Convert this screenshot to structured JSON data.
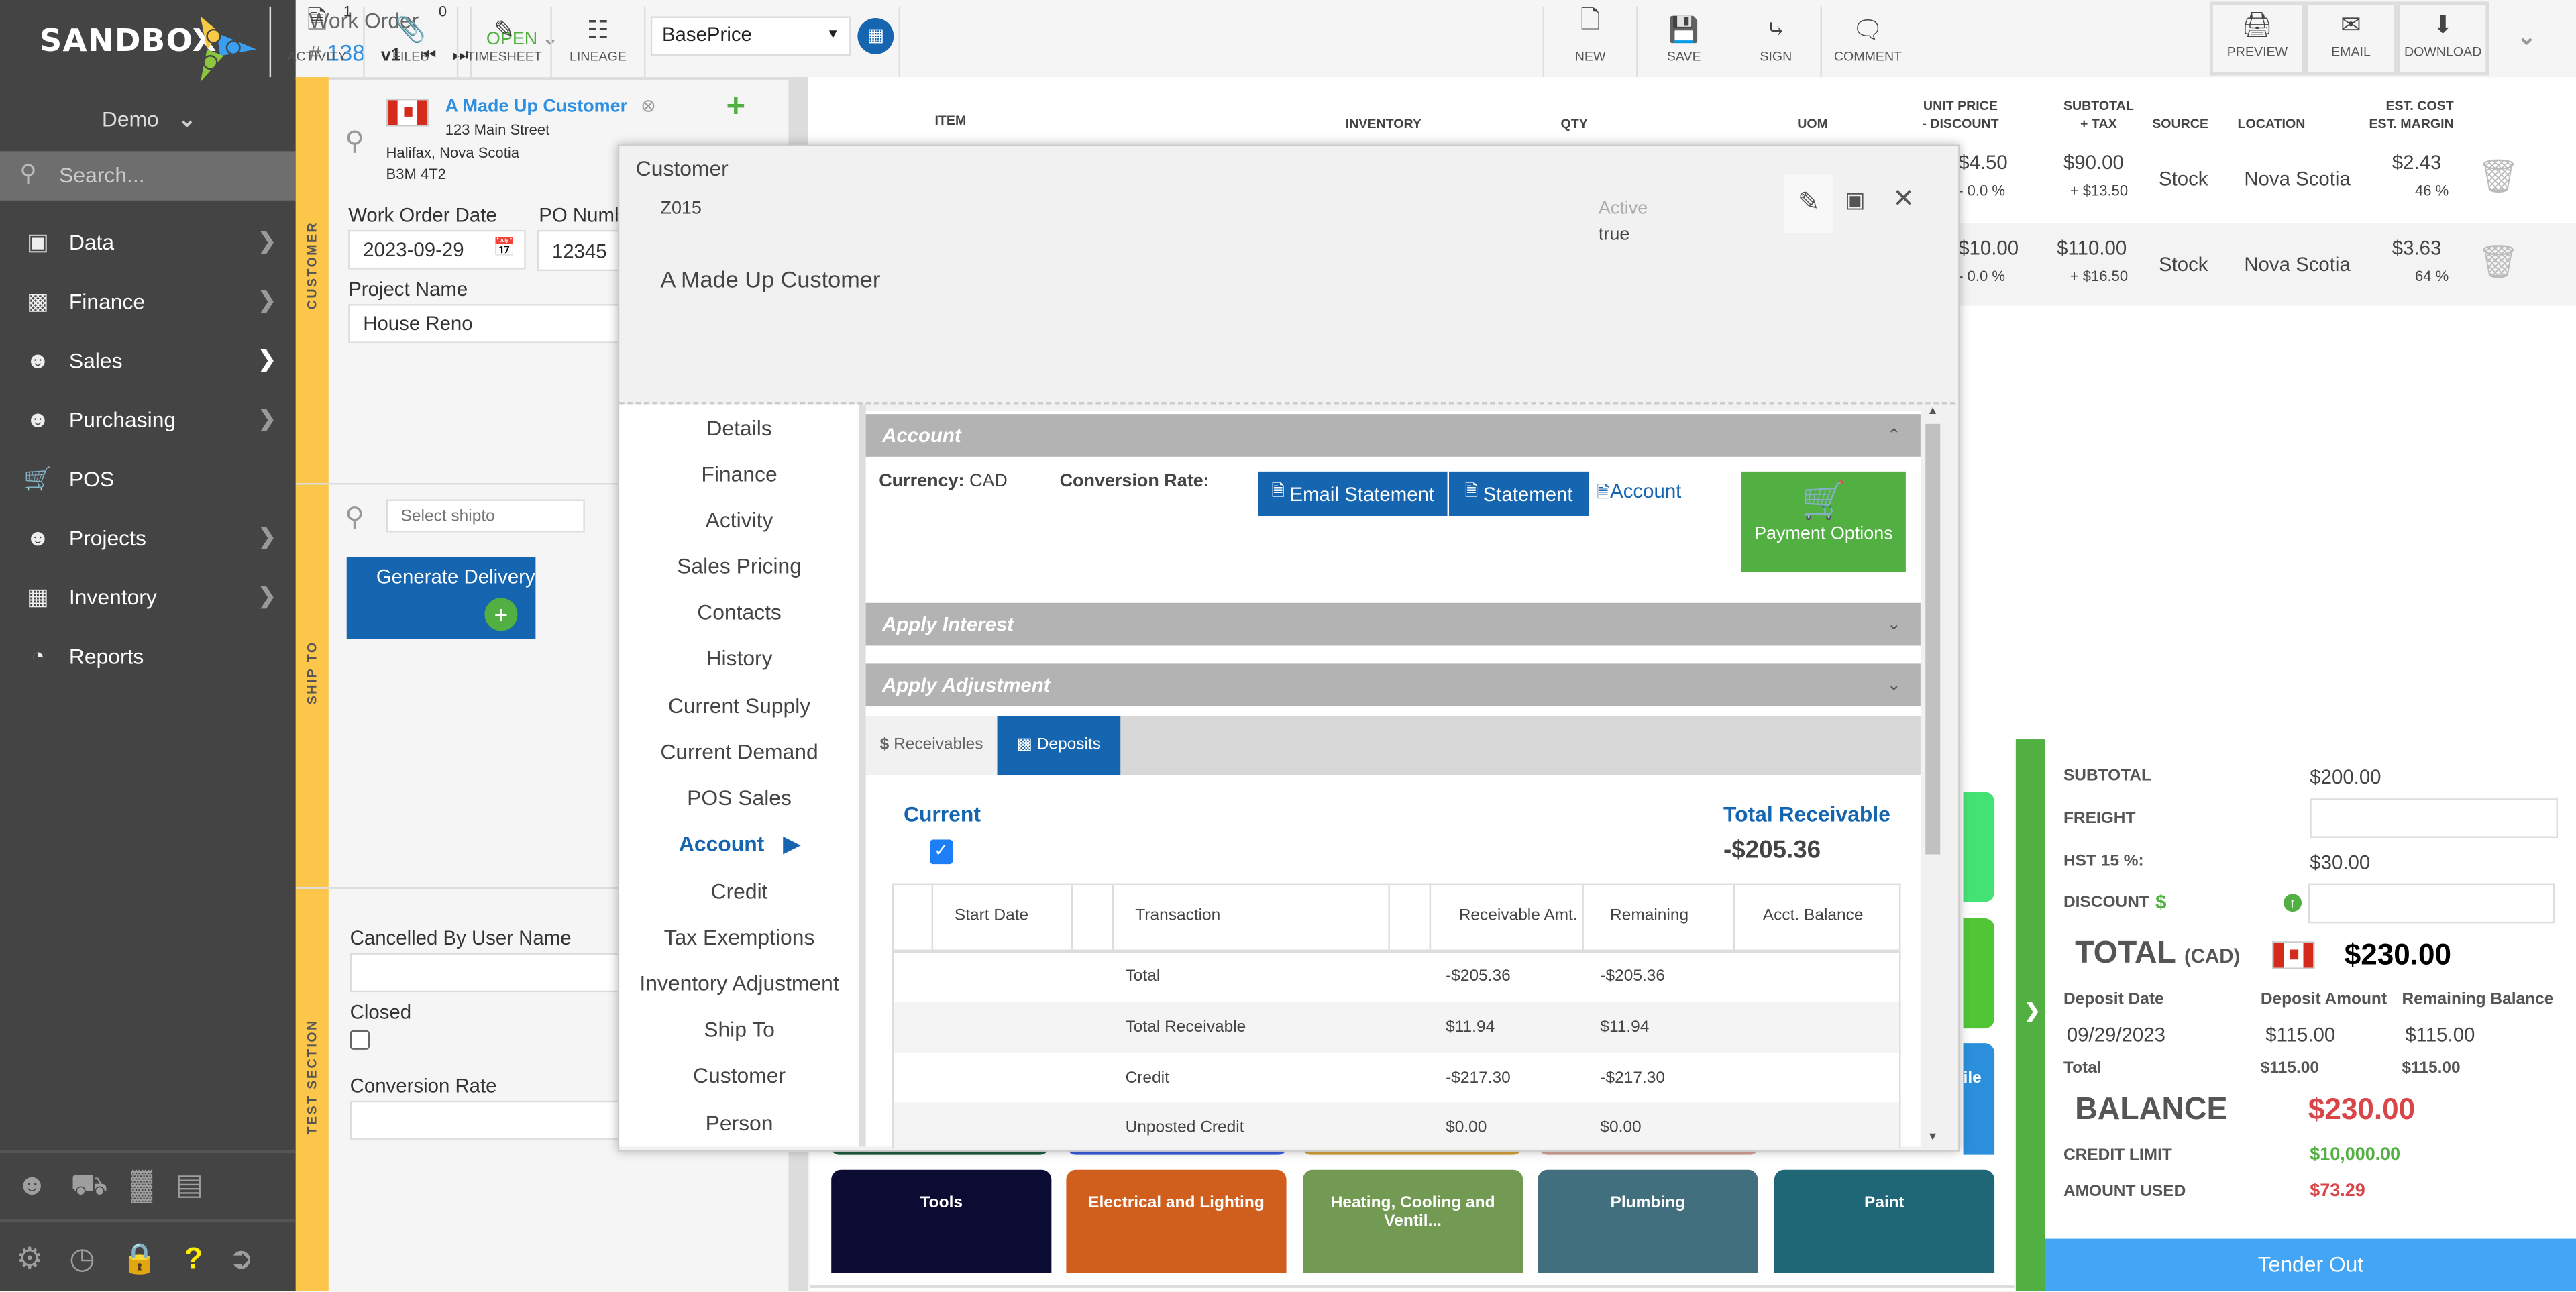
{
  "brand": {
    "name": "SANDBOX",
    "tenant": "Demo"
  },
  "left_nav": {
    "search_placeholder": "Search...",
    "items": [
      {
        "label": "Data",
        "icon": "cube-icon",
        "has_submenu": true
      },
      {
        "label": "Finance",
        "icon": "money-icon",
        "has_submenu": true
      },
      {
        "label": "Sales",
        "icon": "users-icon",
        "has_submenu": true
      },
      {
        "label": "Purchasing",
        "icon": "users-icon",
        "has_submenu": true
      },
      {
        "label": "POS",
        "icon": "cart-icon",
        "has_submenu": false
      },
      {
        "label": "Projects",
        "icon": "users-icon",
        "has_submenu": true
      },
      {
        "label": "Inventory",
        "icon": "cubes-icon",
        "has_submenu": true
      },
      {
        "label": "Reports",
        "icon": "pie-chart-icon",
        "has_submenu": false
      }
    ],
    "quick_icons": [
      "users-icon",
      "truck-icon",
      "factory-icon",
      "archive-icon"
    ],
    "footer_icons": [
      "gear-icon",
      "clock-icon",
      "lock-icon",
      "help-icon",
      "logout-icon"
    ]
  },
  "toolbar": {
    "doc_type": "Work Order",
    "doc_number_prefix": "#",
    "doc_number": "138",
    "version": "v1",
    "status": "OPEN",
    "activity_label": "ACTIVITY",
    "activity_count": "1",
    "files_label": "FILES",
    "files_count": "0",
    "timesheet_label": "TIMESHEET",
    "lineage_label": "LINEAGE",
    "price_list": "BasePrice",
    "new_label": "NEW",
    "save_label": "SAVE",
    "sign_label": "SIGN",
    "comment_label": "COMMENT",
    "preview_label": "PREVIEW",
    "email_label": "EMAIL",
    "download_label": "DOWNLOAD"
  },
  "customer_panel": {
    "section_label": "CUSTOMER",
    "name": "A Made Up Customer",
    "address1": "123 Main Street",
    "address2": "Halifax, Nova Scotia",
    "postal": "B3M 4T2",
    "work_order_date_label": "Work Order Date",
    "work_order_date": "2023-09-29",
    "po_number_label": "PO Numb",
    "po_number": "12345",
    "project_name_label": "Project Name",
    "project_name": "House Reno"
  },
  "ship_to_panel": {
    "section_label": "SHIP TO",
    "search_placeholder": "Select shipto",
    "generate_delivery_label": "Generate Delivery"
  },
  "test_section": {
    "section_label": "TEST SECTION",
    "cancelled_by_label": "Cancelled By User Name",
    "cancelled_by_value": "",
    "closed_label": "Closed",
    "closed_checked": false,
    "conversion_rate_label": "Conversion Rate",
    "conversion_rate_value": ""
  },
  "items_table": {
    "headers": {
      "item": "ITEM",
      "inventory": "INVENTORY",
      "qty": "QTY",
      "uom": "UOM",
      "unit_price": "UNIT PRICE",
      "discount": "- DISCOUNT",
      "subtotal": "SUBTOTAL",
      "tax": "+ TAX",
      "source": "SOURCE",
      "location": "LOCATION",
      "est_cost": "EST. COST",
      "est_margin": "EST. MARGIN"
    },
    "rows": [
      {
        "unit_price": "$4.50",
        "discount": "- 0.0 %",
        "subtotal": "$90.00",
        "tax": "+ $13.50",
        "source": "Stock",
        "location": "Nova Scotia",
        "est_cost": "$2.43",
        "est_margin": "46 %"
      },
      {
        "unit_price": "$10.00",
        "discount": "- 0.0 %",
        "subtotal": "$110.00",
        "tax": "+ $16.50",
        "source": "Stock",
        "location": "Nova Scotia",
        "est_cost": "$3.63",
        "est_margin": "64 %"
      }
    ]
  },
  "modal": {
    "title": "Customer",
    "code": "Z015",
    "name": "A Made Up Customer",
    "active_label": "Active",
    "active_value": "true",
    "nav": [
      "Details",
      "Finance",
      "Activity",
      "Sales Pricing",
      "Contacts",
      "History",
      "Current Supply",
      "Current Demand",
      "POS Sales",
      "Account",
      "Credit",
      "Tax Exemptions",
      "Inventory Adjustment",
      "Ship To",
      "Customer",
      "Person"
    ],
    "active_nav": "Account",
    "account": {
      "header": "Account",
      "currency_label": "Currency:",
      "currency": "CAD",
      "conversion_rate_label": "Conversion Rate:",
      "email_statement_label": "Email Statement",
      "statement_label": "Statement",
      "account_link_label": "Account",
      "payment_options_label": "Payment Options"
    },
    "apply_interest_label": "Apply Interest",
    "apply_adjustment_label": "Apply Adjustment",
    "tabs": [
      {
        "label": "Receivables",
        "active": false
      },
      {
        "label": "Deposits",
        "active": true
      }
    ],
    "receivables": {
      "current_label": "Current",
      "current_checked": true,
      "total_receivable_label": "Total Receivable",
      "total_receivable_value": "-$205.36",
      "columns": [
        "Start Date",
        "Transaction",
        "Receivable Amt.",
        "Remaining",
        "Acct. Balance"
      ],
      "rows": [
        {
          "transaction": "Total",
          "receivable_amt": "-$205.36",
          "remaining": "-$205.36"
        },
        {
          "transaction": "Total Receivable",
          "receivable_amt": "$11.94",
          "remaining": "$11.94"
        },
        {
          "transaction": "Credit",
          "receivable_amt": "-$217.30",
          "remaining": "-$217.30"
        },
        {
          "transaction": "Unposted Credit",
          "receivable_amt": "$0.00",
          "remaining": "$0.00"
        }
      ]
    }
  },
  "category_tiles": [
    {
      "label": "Tools",
      "color": "#0b0b33"
    },
    {
      "label": "Electrical and Lighting",
      "color": "#d05e1c"
    },
    {
      "label": "Heating, Cooling and Ventil...",
      "color": "#729a53"
    },
    {
      "label": "Plumbing",
      "color": "#416f7d"
    },
    {
      "label": "Paint",
      "color": "#1f6677"
    }
  ],
  "partial_tiles": {
    "tile5_partial_label": "ile",
    "colors": [
      "#1d5e3f",
      "#3a5de0",
      "#d7a33b",
      "#d4a59a",
      "#2b8fdb"
    ],
    "side_colors": [
      "#44e274",
      "#50c535",
      "#2b8fdb"
    ]
  },
  "summary": {
    "subtotal_label": "SUBTOTAL",
    "subtotal": "$200.00",
    "freight_label": "FREIGHT",
    "freight": "",
    "hst_label": "HST 15 %:",
    "hst": "$30.00",
    "discount_label": "DISCOUNT",
    "discount": "",
    "total_label": "TOTAL",
    "total_currency": "(CAD)",
    "total": "$230.00",
    "deposit_date_label": "Deposit Date",
    "deposit_amount_label": "Deposit Amount",
    "remaining_balance_label": "Remaining Balance",
    "deposit_date": "09/29/2023",
    "deposit_amount": "$115.00",
    "remaining_balance": "$115.00",
    "deposit_total_label": "Total",
    "deposit_total_amount": "$115.00",
    "deposit_total_remaining": "$115.00",
    "balance_label": "BALANCE",
    "balance": "$230.00",
    "credit_limit_label": "CREDIT LIMIT",
    "credit_limit": "$10,000.00",
    "amount_used_label": "AMOUNT USED",
    "amount_used": "$73.29",
    "tender_out_label": "Tender Out"
  },
  "colors": {
    "accent_blue": "#1565b0",
    "brand_green": "#52b043",
    "section_yellow": "#fbc64a",
    "negative_red": "#d9464a",
    "tender_blue": "#42a5f5"
  }
}
